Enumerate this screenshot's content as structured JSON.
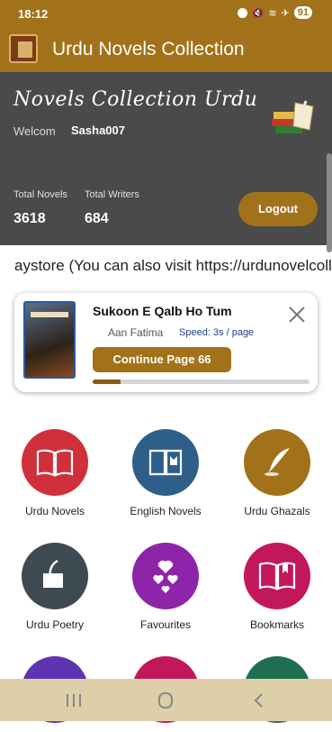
{
  "status_bar": {
    "time": "18:12",
    "battery": "91"
  },
  "app_bar": {
    "title": "Urdu Novels Collection"
  },
  "hero": {
    "title": "Novels Collection Urdu",
    "welcome_label": "Welcom",
    "username": "Sasha007",
    "stats": [
      {
        "label": "Total Novels",
        "value": "3618"
      },
      {
        "label": "Total Writers",
        "value": "684"
      }
    ],
    "logout_label": "Logout"
  },
  "marquee_text": "aystore (You can also visit https://urdunovelcollection.com)",
  "reading_card": {
    "title": "Sukoon E Qalb Ho Tum",
    "author": "Aan Fatima",
    "speed": "Speed: 3s / page",
    "continue_label": "Continue Page 66",
    "progress": 0.13
  },
  "tiles": [
    {
      "label": "Urdu Novels",
      "color": "#d0303a",
      "icon": "open-book-icon"
    },
    {
      "label": "English Novels",
      "color": "#2e5f8a",
      "icon": "book-icon"
    },
    {
      "label": "Urdu Ghazals",
      "color": "#a2721a",
      "icon": "quill-icon"
    },
    {
      "label": "Urdu Poetry",
      "color": "#3d4a52",
      "icon": "scroll-quill-icon"
    },
    {
      "label": "Favourites",
      "color": "#8e24aa",
      "icon": "hearts-icon"
    },
    {
      "label": "Bookmarks",
      "color": "#c2185b",
      "icon": "bookmark-book-icon"
    },
    {
      "label": "",
      "color": "#5e35b1",
      "icon": "more-icon"
    },
    {
      "label": "",
      "color": "#c2185b",
      "icon": "more-icon"
    },
    {
      "label": "",
      "color": "#1f6e52",
      "icon": "more-icon"
    }
  ]
}
